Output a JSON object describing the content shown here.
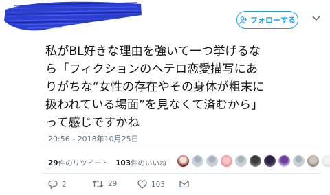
{
  "header": {
    "follow_label": "フォローする",
    "follow_icon": "add-person-icon",
    "menu_icon": "chevron-down-icon"
  },
  "tweet": {
    "lines": [
      "私がBL好きな理由を強いて一つ挙げるな",
      "ら「フィクションのヘテロ恋愛描写にあ",
      "りがちな“女性の存在やその身体が粗末に",
      "扱われている場面”を見なくて済むから」",
      "って感じですかね"
    ],
    "timestamp": "20:56 - 2018年10月25日"
  },
  "stats": {
    "retweets_count": "29",
    "retweets_label": "件のリツイート",
    "likes_count": "103",
    "likes_label": "件のいいね"
  },
  "actions": {
    "reply_count": "2",
    "retweet_count": "29",
    "like_count": "103"
  },
  "colors": {
    "accent": "#1da1f2",
    "scribble": "#2b3fd0",
    "muted": "#657786"
  }
}
